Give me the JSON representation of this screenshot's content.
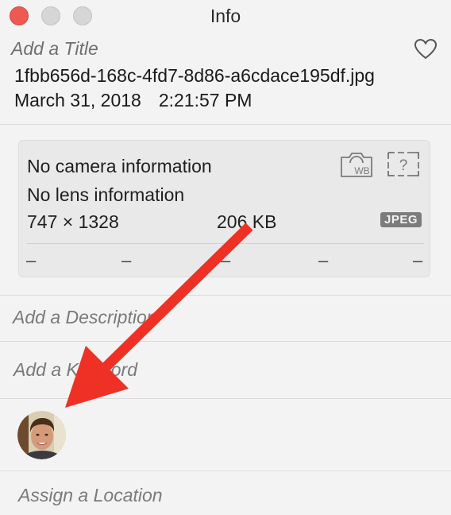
{
  "window": {
    "title": "Info"
  },
  "header": {
    "title_placeholder": "Add a Title",
    "filename": "1fbb656d-168c-4fd7-8d86-a6cdace195df.jpg",
    "date": "March 31, 2018",
    "time": "2:21:57 PM"
  },
  "camera_panel": {
    "camera": "No camera information",
    "lens": "No lens information",
    "dimensions": "747 × 1328",
    "size": "206 KB",
    "format": "JPEG",
    "wb_label": "WB",
    "unknown_label": "?",
    "exif_values": [
      "–",
      "–",
      "–",
      "–",
      "–"
    ]
  },
  "fields": {
    "description_placeholder": "Add a Description",
    "keyword_placeholder": "Add a Keyword",
    "location_placeholder": "Assign a Location"
  },
  "colors": {
    "annotation_arrow": "#ee3124",
    "close_button": "#ee5a52"
  },
  "icons": {
    "favorite": "heart-icon",
    "camera_wb": "camera-wb-icon",
    "unknown_lens": "question-box-icon",
    "person": "face-avatar"
  }
}
